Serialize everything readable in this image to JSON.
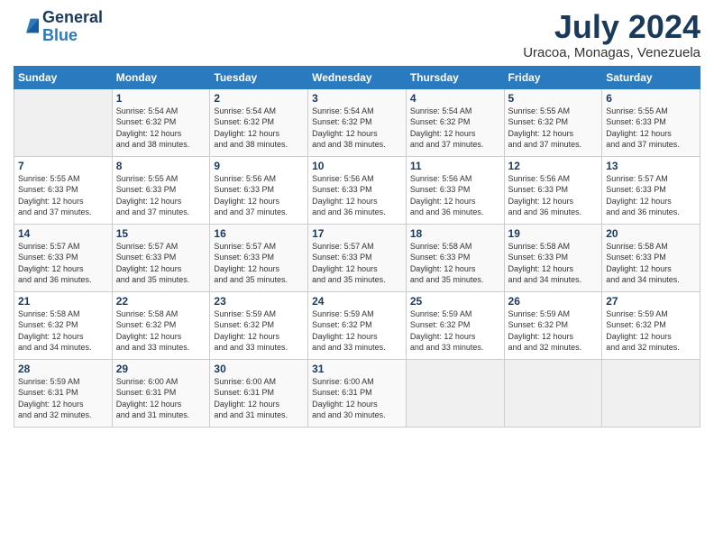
{
  "header": {
    "logo_general": "General",
    "logo_blue": "Blue",
    "month_year": "July 2024",
    "location": "Uracoa, Monagas, Venezuela"
  },
  "days_of_week": [
    "Sunday",
    "Monday",
    "Tuesday",
    "Wednesday",
    "Thursday",
    "Friday",
    "Saturday"
  ],
  "weeks": [
    [
      {
        "day": "",
        "sunrise": "",
        "sunset": "",
        "daylight": ""
      },
      {
        "day": "1",
        "sunrise": "Sunrise: 5:54 AM",
        "sunset": "Sunset: 6:32 PM",
        "daylight": "Daylight: 12 hours and 38 minutes."
      },
      {
        "day": "2",
        "sunrise": "Sunrise: 5:54 AM",
        "sunset": "Sunset: 6:32 PM",
        "daylight": "Daylight: 12 hours and 38 minutes."
      },
      {
        "day": "3",
        "sunrise": "Sunrise: 5:54 AM",
        "sunset": "Sunset: 6:32 PM",
        "daylight": "Daylight: 12 hours and 38 minutes."
      },
      {
        "day": "4",
        "sunrise": "Sunrise: 5:54 AM",
        "sunset": "Sunset: 6:32 PM",
        "daylight": "Daylight: 12 hours and 37 minutes."
      },
      {
        "day": "5",
        "sunrise": "Sunrise: 5:55 AM",
        "sunset": "Sunset: 6:32 PM",
        "daylight": "Daylight: 12 hours and 37 minutes."
      },
      {
        "day": "6",
        "sunrise": "Sunrise: 5:55 AM",
        "sunset": "Sunset: 6:33 PM",
        "daylight": "Daylight: 12 hours and 37 minutes."
      }
    ],
    [
      {
        "day": "7",
        "sunrise": "Sunrise: 5:55 AM",
        "sunset": "Sunset: 6:33 PM",
        "daylight": "Daylight: 12 hours and 37 minutes."
      },
      {
        "day": "8",
        "sunrise": "Sunrise: 5:55 AM",
        "sunset": "Sunset: 6:33 PM",
        "daylight": "Daylight: 12 hours and 37 minutes."
      },
      {
        "day": "9",
        "sunrise": "Sunrise: 5:56 AM",
        "sunset": "Sunset: 6:33 PM",
        "daylight": "Daylight: 12 hours and 37 minutes."
      },
      {
        "day": "10",
        "sunrise": "Sunrise: 5:56 AM",
        "sunset": "Sunset: 6:33 PM",
        "daylight": "Daylight: 12 hours and 36 minutes."
      },
      {
        "day": "11",
        "sunrise": "Sunrise: 5:56 AM",
        "sunset": "Sunset: 6:33 PM",
        "daylight": "Daylight: 12 hours and 36 minutes."
      },
      {
        "day": "12",
        "sunrise": "Sunrise: 5:56 AM",
        "sunset": "Sunset: 6:33 PM",
        "daylight": "Daylight: 12 hours and 36 minutes."
      },
      {
        "day": "13",
        "sunrise": "Sunrise: 5:57 AM",
        "sunset": "Sunset: 6:33 PM",
        "daylight": "Daylight: 12 hours and 36 minutes."
      }
    ],
    [
      {
        "day": "14",
        "sunrise": "Sunrise: 5:57 AM",
        "sunset": "Sunset: 6:33 PM",
        "daylight": "Daylight: 12 hours and 36 minutes."
      },
      {
        "day": "15",
        "sunrise": "Sunrise: 5:57 AM",
        "sunset": "Sunset: 6:33 PM",
        "daylight": "Daylight: 12 hours and 35 minutes."
      },
      {
        "day": "16",
        "sunrise": "Sunrise: 5:57 AM",
        "sunset": "Sunset: 6:33 PM",
        "daylight": "Daylight: 12 hours and 35 minutes."
      },
      {
        "day": "17",
        "sunrise": "Sunrise: 5:57 AM",
        "sunset": "Sunset: 6:33 PM",
        "daylight": "Daylight: 12 hours and 35 minutes."
      },
      {
        "day": "18",
        "sunrise": "Sunrise: 5:58 AM",
        "sunset": "Sunset: 6:33 PM",
        "daylight": "Daylight: 12 hours and 35 minutes."
      },
      {
        "day": "19",
        "sunrise": "Sunrise: 5:58 AM",
        "sunset": "Sunset: 6:33 PM",
        "daylight": "Daylight: 12 hours and 34 minutes."
      },
      {
        "day": "20",
        "sunrise": "Sunrise: 5:58 AM",
        "sunset": "Sunset: 6:33 PM",
        "daylight": "Daylight: 12 hours and 34 minutes."
      }
    ],
    [
      {
        "day": "21",
        "sunrise": "Sunrise: 5:58 AM",
        "sunset": "Sunset: 6:32 PM",
        "daylight": "Daylight: 12 hours and 34 minutes."
      },
      {
        "day": "22",
        "sunrise": "Sunrise: 5:58 AM",
        "sunset": "Sunset: 6:32 PM",
        "daylight": "Daylight: 12 hours and 33 minutes."
      },
      {
        "day": "23",
        "sunrise": "Sunrise: 5:59 AM",
        "sunset": "Sunset: 6:32 PM",
        "daylight": "Daylight: 12 hours and 33 minutes."
      },
      {
        "day": "24",
        "sunrise": "Sunrise: 5:59 AM",
        "sunset": "Sunset: 6:32 PM",
        "daylight": "Daylight: 12 hours and 33 minutes."
      },
      {
        "day": "25",
        "sunrise": "Sunrise: 5:59 AM",
        "sunset": "Sunset: 6:32 PM",
        "daylight": "Daylight: 12 hours and 33 minutes."
      },
      {
        "day": "26",
        "sunrise": "Sunrise: 5:59 AM",
        "sunset": "Sunset: 6:32 PM",
        "daylight": "Daylight: 12 hours and 32 minutes."
      },
      {
        "day": "27",
        "sunrise": "Sunrise: 5:59 AM",
        "sunset": "Sunset: 6:32 PM",
        "daylight": "Daylight: 12 hours and 32 minutes."
      }
    ],
    [
      {
        "day": "28",
        "sunrise": "Sunrise: 5:59 AM",
        "sunset": "Sunset: 6:31 PM",
        "daylight": "Daylight: 12 hours and 32 minutes."
      },
      {
        "day": "29",
        "sunrise": "Sunrise: 6:00 AM",
        "sunset": "Sunset: 6:31 PM",
        "daylight": "Daylight: 12 hours and 31 minutes."
      },
      {
        "day": "30",
        "sunrise": "Sunrise: 6:00 AM",
        "sunset": "Sunset: 6:31 PM",
        "daylight": "Daylight: 12 hours and 31 minutes."
      },
      {
        "day": "31",
        "sunrise": "Sunrise: 6:00 AM",
        "sunset": "Sunset: 6:31 PM",
        "daylight": "Daylight: 12 hours and 30 minutes."
      },
      {
        "day": "",
        "sunrise": "",
        "sunset": "",
        "daylight": ""
      },
      {
        "day": "",
        "sunrise": "",
        "sunset": "",
        "daylight": ""
      },
      {
        "day": "",
        "sunrise": "",
        "sunset": "",
        "daylight": ""
      }
    ]
  ]
}
